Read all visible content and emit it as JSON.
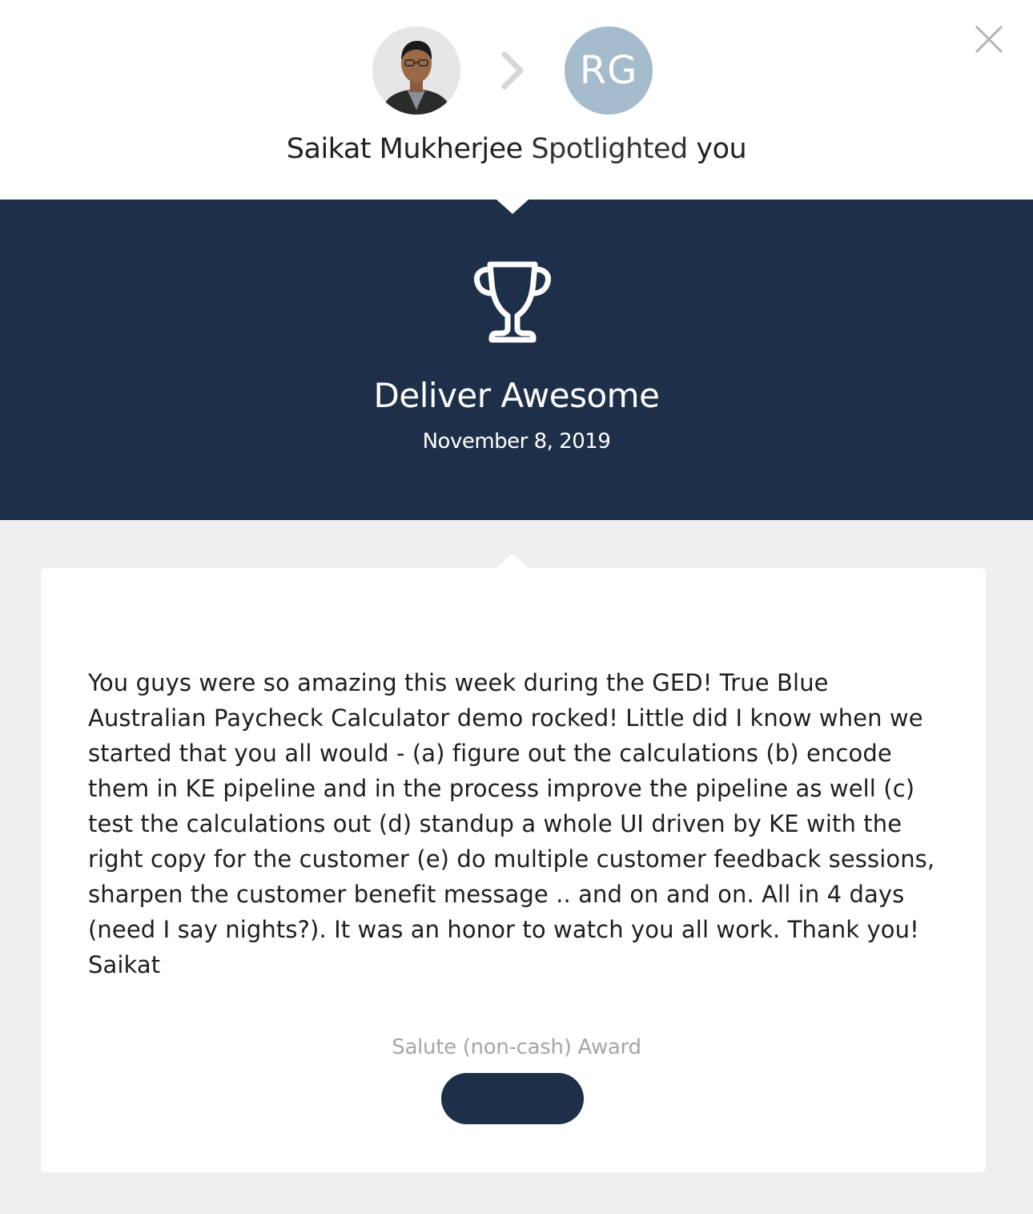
{
  "header": {
    "sender_name": "Saikat Mukherjee",
    "verb": "Spotlighted",
    "recipient": "you",
    "recipient_initials": "RG",
    "recipient_avatar_color": "#a4bccb",
    "close_icon": "close-icon",
    "separator_icon": "chevron-right-icon"
  },
  "award": {
    "icon": "trophy-icon",
    "title": "Deliver Awesome",
    "date": "November 8, 2019",
    "banner_color": "#1e3049"
  },
  "message": {
    "text": "You guys were so amazing this week during the GED! True Blue Australian Paycheck Calculator demo rocked! Little did I know when we started that you all would - (a) figure out the calculations (b) encode them in KE pipeline and in the process improve the pipeline as well (c) test the calculations out (d) standup a whole UI driven by KE with the right copy for the customer (e) do multiple customer feedback sessions, sharpen the customer benefit message .. and on and on. All in 4 days (need I say nights?). It was an honor to watch you all work. Thank you! Saikat"
  },
  "footer": {
    "award_type": "Salute (non-cash) Award",
    "action_label": ""
  }
}
